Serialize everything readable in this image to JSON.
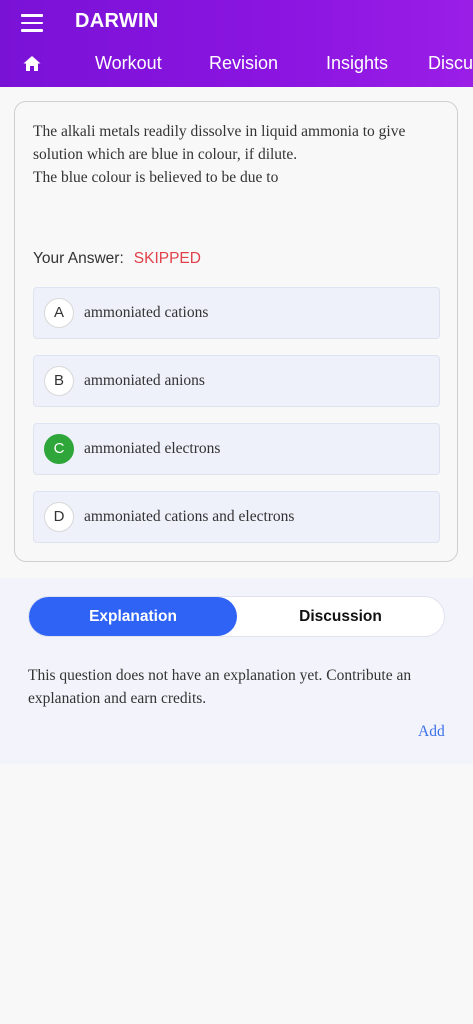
{
  "header": {
    "app_title": "DARWIN",
    "menu_icon": "hamburger-menu-icon",
    "home_icon": "home-icon",
    "tabs": [
      {
        "label": "Workout"
      },
      {
        "label": "Revision"
      },
      {
        "label": "Insights"
      },
      {
        "label": "Discu"
      }
    ],
    "gradient_colors": [
      "#7a12d6",
      "#9a1ee6"
    ]
  },
  "question": {
    "line1": "The alkali metals readily dissolve in liquid ammonia to give solution which are blue in colour, if dilute.",
    "line2": "The blue colour is believed to be due to"
  },
  "answer": {
    "label": "Your Answer:",
    "value": "SKIPPED",
    "value_color": "#e0404a"
  },
  "options": [
    {
      "letter": "A",
      "text": "ammoniated cations",
      "correct": false
    },
    {
      "letter": "B",
      "text": "ammoniated anions",
      "correct": false
    },
    {
      "letter": "C",
      "text": "ammoniated electrons",
      "correct": true
    },
    {
      "letter": "D",
      "text": "ammoniated cations and electrons",
      "correct": false
    }
  ],
  "tabs_bottom": {
    "explanation": "Explanation",
    "discussion": "Discussion",
    "active": "explanation",
    "accent_color": "#2f63f5"
  },
  "explanation": {
    "text": "This question does not have an explanation yet. Contribute an explanation and earn credits.",
    "add_label": "Add"
  }
}
